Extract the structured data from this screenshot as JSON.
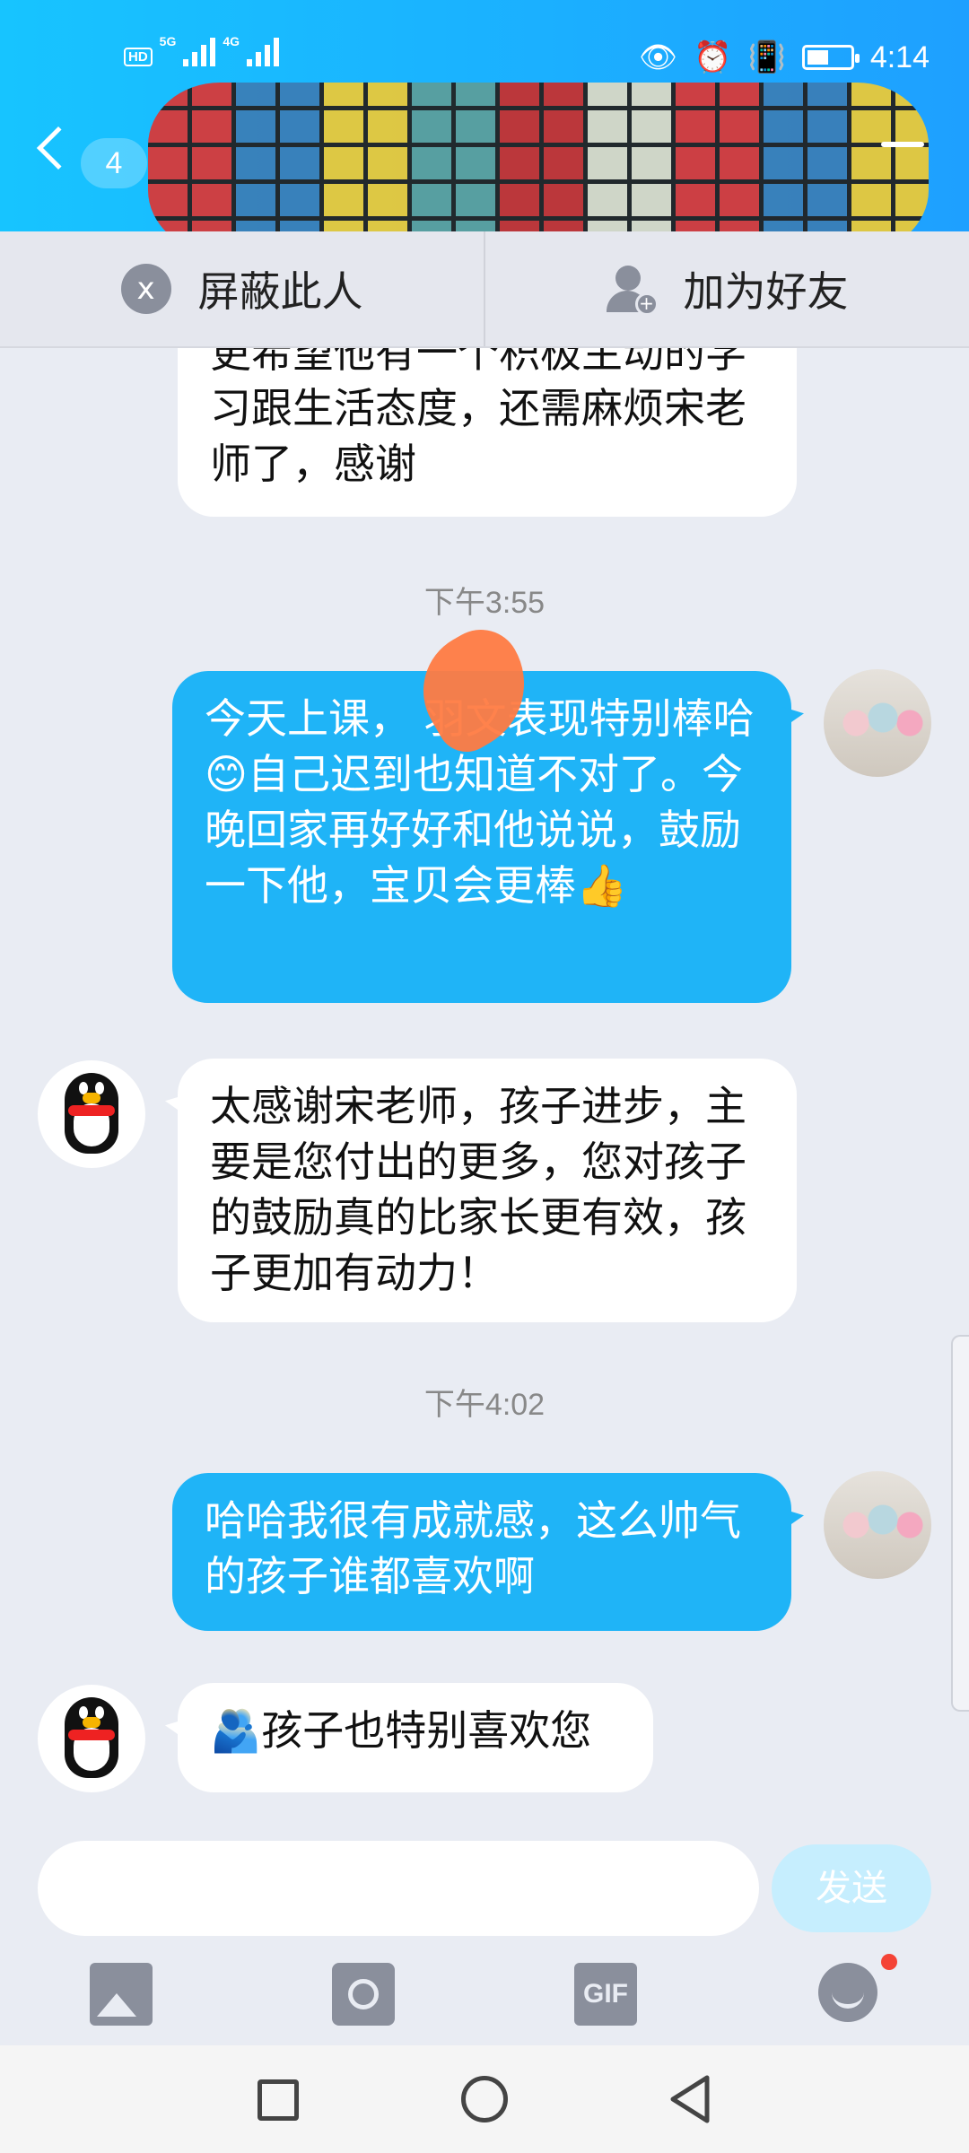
{
  "status_bar": {
    "network_left": "HD",
    "net_5g": "5G",
    "net_4g": "4G",
    "time": "4:14",
    "battery_level": 0.5
  },
  "header": {
    "unread_count": "4"
  },
  "actions": {
    "block": "屏蔽此人",
    "add_friend": "加为好友"
  },
  "messages": [
    {
      "side": "in",
      "text": "更希望他有一个积极主动的学习跟生活态度，还需麻烦宋老师了，感谢"
    },
    {
      "time": "下午3:55"
    },
    {
      "side": "out",
      "text": "今天上课，  羽文表现特别棒哈😊自己迟到也知道不对了。今晚回家再好好和他说说，鼓励一下他，宝贝会更棒👍"
    },
    {
      "side": "in",
      "text": "太感谢宋老师，孩子进步，主要是您付出的更多，您对孩子的鼓励真的比家长更有效，孩子更加有动力！"
    },
    {
      "time": "下午4:02"
    },
    {
      "side": "out",
      "text": "哈哈我很有成就感，这么帅气的孩子谁都喜欢啊"
    },
    {
      "side": "in",
      "text": "🫂孩子也特别喜欢您"
    }
  ],
  "input": {
    "placeholder": "",
    "send_label": "发送"
  },
  "toolbar": {
    "gif_label": "GIF"
  },
  "icons": [
    "chevron-left-icon",
    "menu-icon",
    "block-icon",
    "add-user-icon",
    "image-icon",
    "camera-icon",
    "gif-icon",
    "emoji-icon"
  ],
  "colors": {
    "header": "#1ea0ff",
    "outgoing_bubble": "#1fb4f7",
    "incoming_bubble": "#ffffff",
    "background": "#e9ecf3"
  }
}
